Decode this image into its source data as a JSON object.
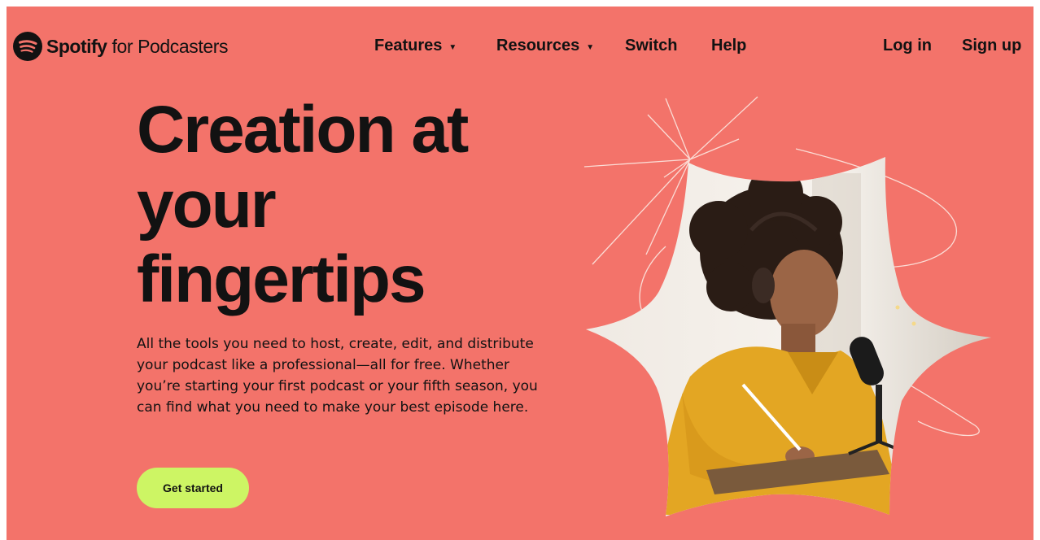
{
  "nav": {
    "brand_name": "Spotify",
    "brand_sub": "for Podcasters",
    "features": "Features",
    "resources": "Resources",
    "switch": "Switch",
    "help": "Help",
    "login": "Log in",
    "signup": "Sign up",
    "caret_icon": "caret-down-icon"
  },
  "hero": {
    "title_line1": "Creation at",
    "title_line2": "your",
    "title_line3": "fingertips",
    "description": "All the tools you need to host, create, edit, and distribute your podcast like a professional—all for free. Whether you’re starting your first podcast or your fifth season, you can find what you need to make your best episode here.",
    "cta_label": "Get started"
  },
  "colors": {
    "background": "#f3736a",
    "text": "#121212",
    "cta": "#cdf564",
    "sweater": "#e3a623"
  }
}
